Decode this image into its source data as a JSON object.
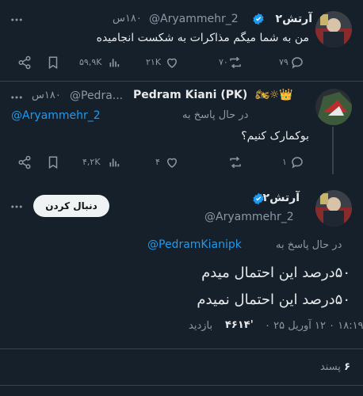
{
  "colors": {
    "background": "#15202b",
    "accent": "#1d9bf0",
    "text": "#e7e9ea",
    "muted": "#8b98a5",
    "verified": "#1d9bf0"
  },
  "tweet1": {
    "display_name": "آرتش۲",
    "handle": "@Aryammehr_2",
    "time": "۱۸۰س",
    "text": "من به شما میگم مذاکرات به شکست انجامیده",
    "stats": {
      "views": "۵۹,۹K",
      "likes": "۲۱K",
      "retweets": "۷۰",
      "replies": "۷۹"
    }
  },
  "tweet2": {
    "display_name": "Pedram Kiani (PK)",
    "emoji_suffix": "🏍☼👑",
    "handle": "@Pedra...",
    "time": "۱۸۰س",
    "reply_prefix": "در حال پاسخ به",
    "reply_handle": "@Aryammehr_2",
    "text": "بوکمارک کنیم؟",
    "stats": {
      "views": "۴,۲K",
      "likes": "۴",
      "replies": "۱"
    }
  },
  "tweet3": {
    "display_name": "آرتش۲",
    "handle": "@Aryammehr_2",
    "follow_label": "دنبال کردن",
    "reply_prefix": "در حال پاسخ به",
    "reply_handle": "@PedramKianipk",
    "line1": "۵۰درصد این احتمال میدم",
    "line2": "۵۰درصد این احتمال نمیدم",
    "meta_time": "۱۸:۱۹ ۰ ۱۲ آوریل ۲۵ ۰",
    "meta_views": "۴۶۱۴'",
    "meta_views_label": "بازدید",
    "likes_count": "۶",
    "likes_label": "پسند"
  },
  "icons": [
    "more-icon",
    "reply-icon",
    "retweet-icon",
    "like-icon",
    "views-icon",
    "bookmark-icon",
    "share-icon",
    "verified-icon"
  ]
}
